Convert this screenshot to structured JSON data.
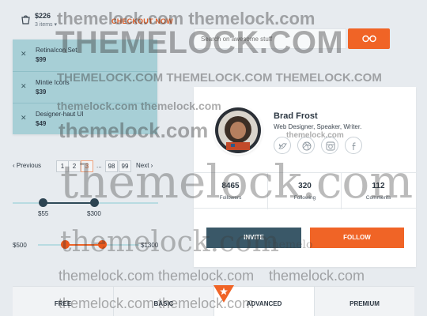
{
  "cart": {
    "total": "$226",
    "count": "3 items ▾",
    "checkout_label": "CHECKOUT NOW",
    "items": [
      {
        "remove": "✕",
        "name": "RetinaIcon Set",
        "price": "$99"
      },
      {
        "remove": "✕",
        "name": "Mintie Icons",
        "price": "$39"
      },
      {
        "remove": "✕",
        "name": "Designer-haut UI",
        "price": "$49"
      }
    ]
  },
  "search": {
    "placeholder": "Search on awesome stuff",
    "button_icon": "glasses-icon"
  },
  "profile": {
    "name": "Brad Frost",
    "role": "Web Designer, Speaker, Writer.",
    "social_icons": [
      "twitter-icon",
      "dribbble-icon",
      "instagram-icon",
      "facebook-icon"
    ],
    "stats": [
      {
        "value": "8465",
        "label": "Followers"
      },
      {
        "value": "320",
        "label": "Following"
      },
      {
        "value": "112",
        "label": "Comments"
      }
    ],
    "invite_label": "INVITE",
    "follow_label": "FOLLOW"
  },
  "pagination": {
    "prev": "‹ Previous",
    "pages": [
      "1",
      "2",
      "3"
    ],
    "active_page": "3",
    "ellipsis": "...",
    "tail_pages": [
      "98",
      "99"
    ],
    "next": "Next ›"
  },
  "range_slider": {
    "min_label": "$55",
    "max_label": "$300",
    "low_fraction": 0.21,
    "high_fraction": 0.56
  },
  "price_slider": {
    "min_label": "$500",
    "max_label": "$1300"
  },
  "plans": {
    "tabs": [
      "FREE",
      "BASIC",
      "ADVANCED",
      "PREMIUM"
    ],
    "featured": "ADVANCED"
  },
  "watermark": {
    "text": "themelock.com",
    "text_wide": "themelock.com themelock.com",
    "text_triple": "THEMELOCK.COM THEMELOCK.COM THEMELOCK.COM",
    "text_upper": "THEMELOCK.COM",
    "text_short": "themelock.com",
    "text_fragment": "themelo"
  },
  "colors": {
    "accent": "#f06426",
    "dark": "#3a5868",
    "dropdown": "#a7cfd6"
  }
}
